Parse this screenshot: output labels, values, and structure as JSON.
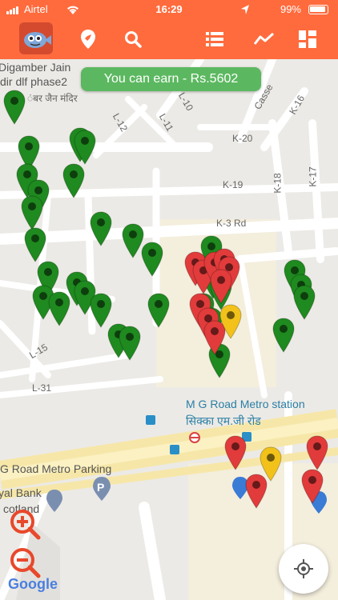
{
  "status": {
    "carrier": "Airtel",
    "time": "16:29",
    "battery": "99%"
  },
  "toolbar": {
    "icons": [
      "app-logo-icon",
      "location-pin-icon",
      "search-icon",
      "list-icon",
      "trend-chart-icon",
      "dashboard-icon"
    ]
  },
  "banner": {
    "earn_text": "You can earn - Rs.5602"
  },
  "map_labels": {
    "place1_line1": "Digamber Jain",
    "place1_line2": "dir dlf phase2",
    "place1_hindi": "ंबर जैन मंदिर",
    "l10": "L-10",
    "l11": "L-11",
    "l12": "L-12",
    "k16": "K-16",
    "k20": "K-20",
    "k19": "K-19",
    "k18": "K-18",
    "k17": "K-17",
    "k3": "K-3 Rd",
    "casse": "Casse",
    "l15": "L-15",
    "l31": "L-31",
    "metro_en": "M G Road Metro station",
    "metro_hi": "सिक्का एम.जी रोड",
    "parking": "G Road Metro Parking",
    "bank1": "yal Bank",
    "bank2": "cotland"
  },
  "pin_colors": {
    "available": "#1f8a1f",
    "taken": "#e23b3b",
    "pending": "#f2c21a"
  },
  "map_controls": {
    "zoom_in_icon": "zoom-in-icon",
    "zoom_out_icon": "zoom-out-icon",
    "locate_icon": "my-location-icon",
    "attribution": "Google"
  }
}
